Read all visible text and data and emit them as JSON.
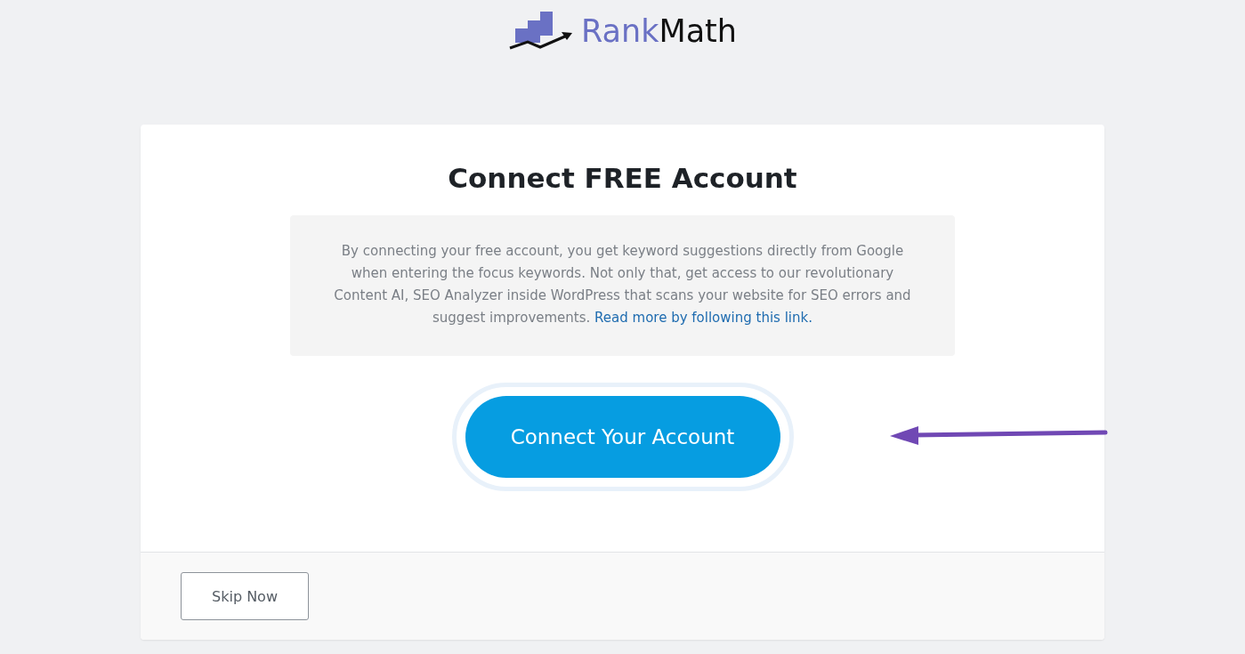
{
  "logo": {
    "brand_first": "Rank",
    "brand_second": "Math"
  },
  "card": {
    "title": "Connect FREE Account",
    "description": {
      "text": "By connecting your free account, you get keyword suggestions directly from Google when entering the focus keywords. Not only that, get access to our revolutionary Content AI, SEO Analyzer inside WordPress that scans your website for SEO errors and suggest improvements.",
      "link": "Read more by following this link."
    },
    "primary_button": "Connect Your Account",
    "skip_button": "Skip Now"
  }
}
